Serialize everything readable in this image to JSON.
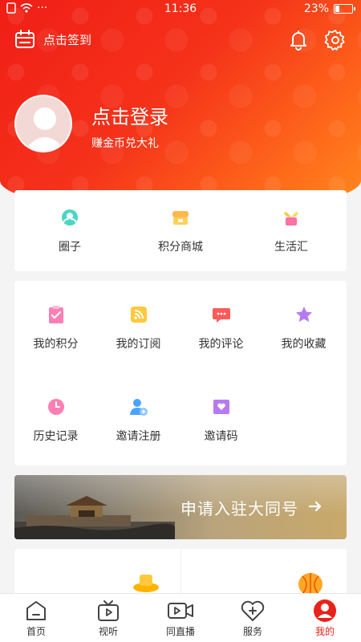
{
  "status_bar": {
    "time": "11:36",
    "battery": "23%",
    "battery_level": 0.23
  },
  "header": {
    "checkin_label": "点击签到",
    "login_title": "点击登录",
    "login_subtitle": "赚金币兑大礼"
  },
  "quick_entries": [
    {
      "label": "圈子",
      "icon": "circle-people-icon"
    },
    {
      "label": "积分商城",
      "icon": "shop-icon"
    },
    {
      "label": "生活汇",
      "icon": "plant-pot-icon"
    }
  ],
  "menu_grid": [
    {
      "label": "我的积分",
      "icon": "clipboard-check-icon"
    },
    {
      "label": "我的订阅",
      "icon": "rss-icon"
    },
    {
      "label": "我的评论",
      "icon": "comment-icon"
    },
    {
      "label": "我的收藏",
      "icon": "star-icon"
    },
    {
      "label": "历史记录",
      "icon": "clock-icon"
    },
    {
      "label": "邀请注册",
      "icon": "add-user-icon"
    },
    {
      "label": "邀请码",
      "icon": "heart-envelope-icon"
    }
  ],
  "banner": {
    "text": "申请入驻大同号"
  },
  "tabbar": [
    {
      "label": "首页",
      "icon": "home-icon"
    },
    {
      "label": "视听",
      "icon": "tv-icon"
    },
    {
      "label": "同直播",
      "icon": "video-camera-icon"
    },
    {
      "label": "服务",
      "icon": "heart-plus-icon"
    },
    {
      "label": "我的",
      "icon": "profile-icon",
      "active": true
    }
  ],
  "colors": {
    "brand_red": "#e8231b",
    "header_orange": "#ff7a1c"
  }
}
